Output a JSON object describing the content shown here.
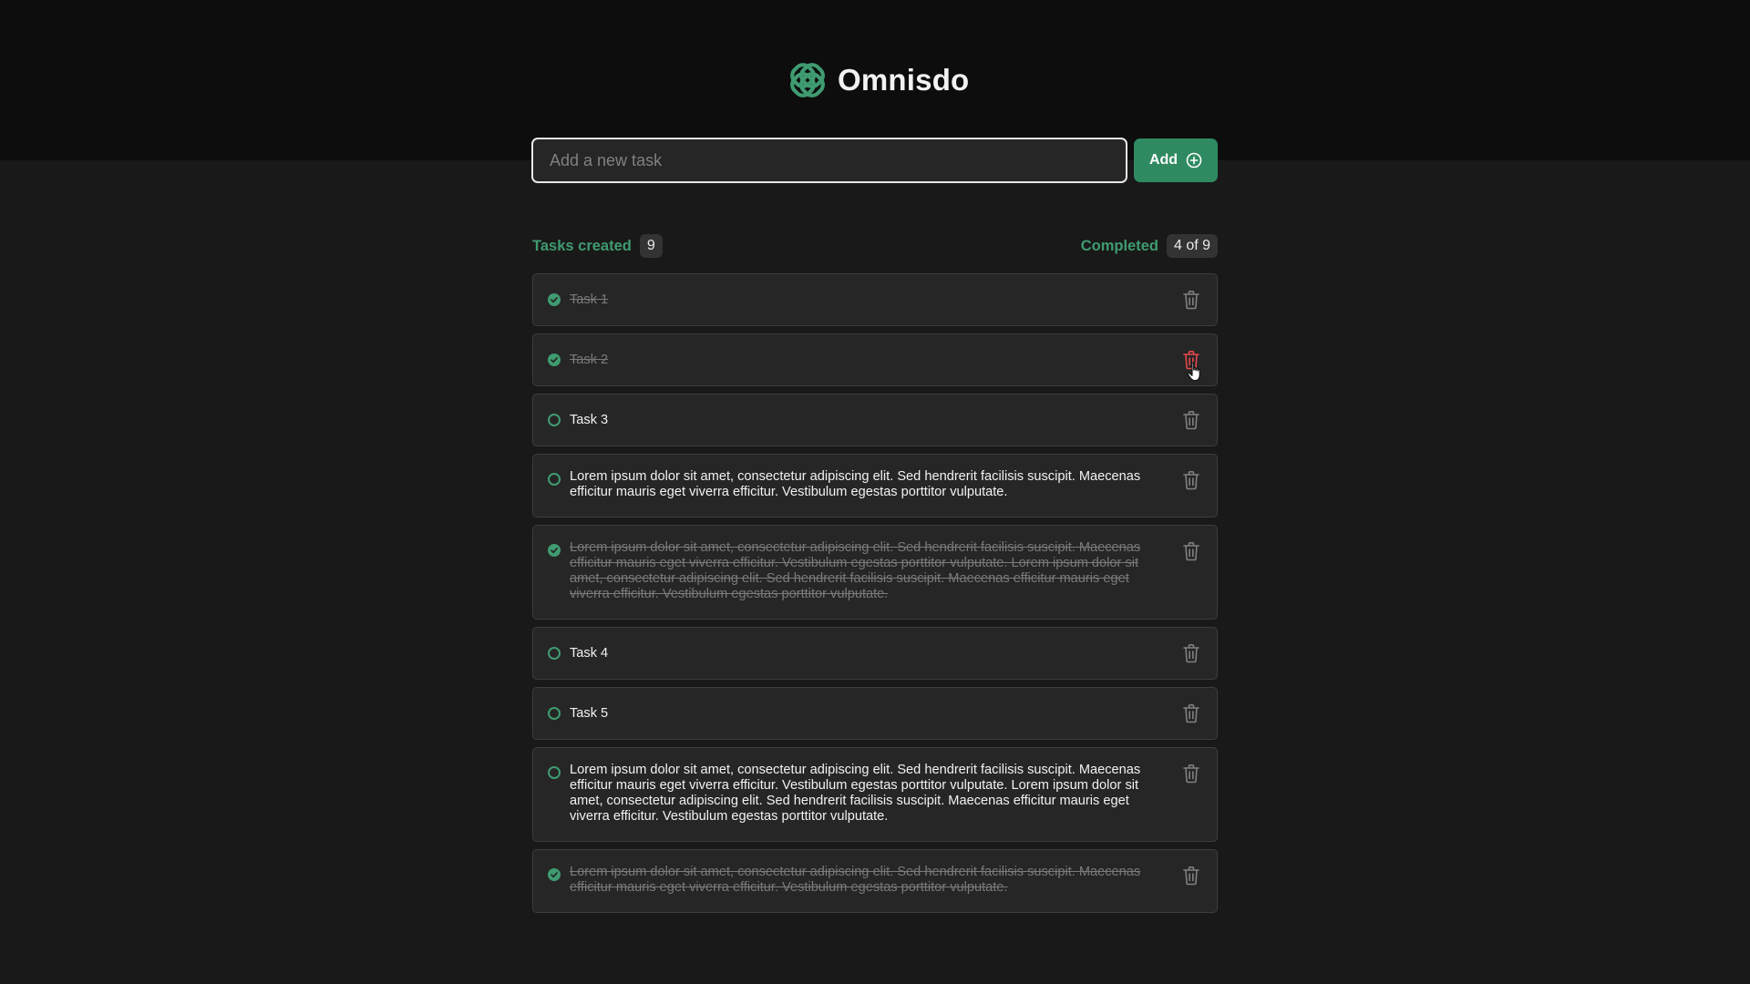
{
  "app": {
    "name": "Omnisdo",
    "logo_icon": "omnisdo-logo-icon",
    "accent_color": "#3f9b70",
    "button_color": "#2f8a61",
    "danger_color": "#e5484d"
  },
  "new_task": {
    "placeholder": "Add a new task",
    "value": "",
    "add_label": "Add",
    "add_icon": "plus-circle-icon"
  },
  "stats": {
    "created_label": "Tasks created",
    "created_count": "9",
    "completed_label": "Completed",
    "completed_count": "4 of 9"
  },
  "tasks": [
    {
      "text": "Task 1",
      "done": true,
      "multiline": false
    },
    {
      "text": "Task 2",
      "done": true,
      "multiline": false,
      "delete_hovered": true
    },
    {
      "text": "Task 3",
      "done": false,
      "multiline": false
    },
    {
      "text": "Lorem ipsum dolor sit amet, consectetur adipiscing elit. Sed hendrerit facilisis suscipit. Maecenas efficitur mauris eget viverra efficitur. Vestibulum egestas porttitor vulputate.",
      "done": false,
      "multiline": true
    },
    {
      "text": "Lorem ipsum dolor sit amet, consectetur adipiscing elit. Sed hendrerit facilisis suscipit. Maecenas efficitur mauris eget viverra efficitur. Vestibulum egestas porttitor vulputate. Lorem ipsum dolor sit amet, consectetur adipiscing elit. Sed hendrerit facilisis suscipit. Maecenas efficitur mauris eget viverra efficitur. Vestibulum egestas porttitor vulputate.",
      "done": true,
      "multiline": true
    },
    {
      "text": "Task 4",
      "done": false,
      "multiline": false
    },
    {
      "text": "Task 5",
      "done": false,
      "multiline": false
    },
    {
      "text": "Lorem ipsum dolor sit amet, consectetur adipiscing elit. Sed hendrerit facilisis suscipit. Maecenas efficitur mauris eget viverra efficitur. Vestibulum egestas porttitor vulputate. Lorem ipsum dolor sit amet, consectetur adipiscing elit. Sed hendrerit facilisis suscipit. Maecenas efficitur mauris eget viverra efficitur. Vestibulum egestas porttitor vulputate.",
      "done": false,
      "multiline": true
    },
    {
      "text": "Lorem ipsum dolor sit amet, consectetur adipiscing elit. Sed hendrerit facilisis suscipit. Maecenas efficitur mauris eget viverra efficitur. Vestibulum egestas porttitor vulputate.",
      "done": true,
      "multiline": true
    }
  ]
}
